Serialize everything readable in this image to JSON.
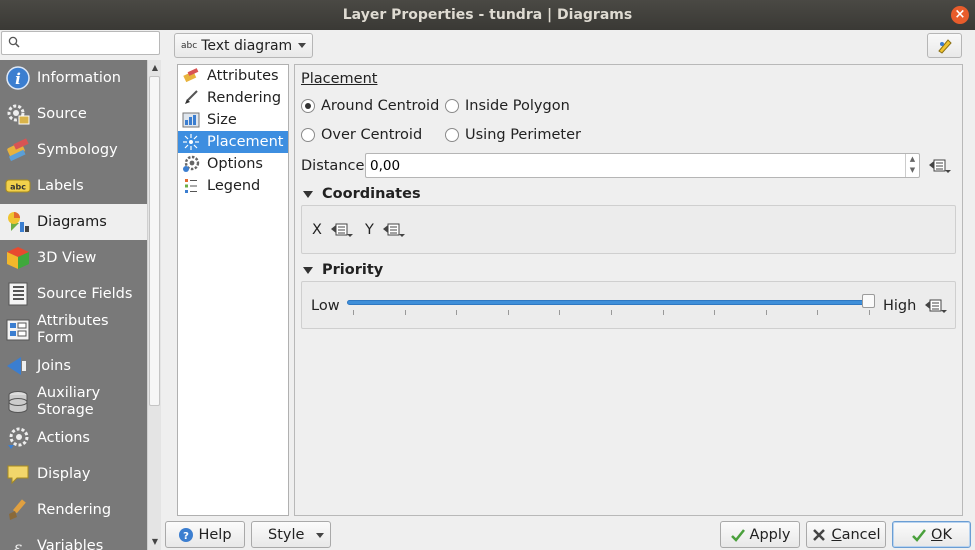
{
  "window": {
    "title": "Layer Properties - tundra | Diagrams",
    "close_glyph": "×"
  },
  "search": {
    "placeholder": ""
  },
  "sidebar": {
    "items": [
      {
        "label": "Information",
        "icon": "info-icon"
      },
      {
        "label": "Source",
        "icon": "source-icon"
      },
      {
        "label": "Symbology",
        "icon": "symbology-icon"
      },
      {
        "label": "Labels",
        "icon": "labels-icon"
      },
      {
        "label": "Diagrams",
        "icon": "diagrams-icon",
        "active": true
      },
      {
        "label": "3D View",
        "icon": "cube-icon"
      },
      {
        "label": "Source Fields",
        "icon": "fields-icon"
      },
      {
        "label": "Attributes\nForm",
        "icon": "form-icon"
      },
      {
        "label": "Joins",
        "icon": "joins-icon"
      },
      {
        "label": "Auxiliary\nStorage",
        "icon": "storage-icon"
      },
      {
        "label": "Actions",
        "icon": "actions-icon"
      },
      {
        "label": "Display",
        "icon": "display-icon"
      },
      {
        "label": "Rendering",
        "icon": "rendering-icon"
      },
      {
        "label": "Variables",
        "icon": "variables-icon"
      }
    ]
  },
  "diagram_type": {
    "prefix": "abc",
    "value": "Text diagram"
  },
  "subnav": {
    "items": [
      {
        "label": "Attributes"
      },
      {
        "label": "Rendering"
      },
      {
        "label": "Size"
      },
      {
        "label": "Placement",
        "active": true
      },
      {
        "label": "Options"
      },
      {
        "label": "Legend"
      }
    ]
  },
  "placement": {
    "title": "Placement",
    "options": {
      "around_centroid": "Around Centroid",
      "inside_polygon": "Inside Polygon",
      "over_centroid": "Over Centroid",
      "using_perimeter": "Using Perimeter"
    },
    "selected": "around_centroid",
    "distance_label": "Distance",
    "distance_value": "0,00"
  },
  "coordinates": {
    "title": "Coordinates",
    "x_label": "X",
    "y_label": "Y"
  },
  "priority": {
    "title": "Priority",
    "low_label": "Low",
    "high_label": "High",
    "value_fraction": 1.0
  },
  "buttons": {
    "help": "Help",
    "style": "Style",
    "apply": "Apply",
    "cancel_first": "C",
    "cancel_rest": "ancel",
    "ok_first": "O",
    "ok_rest": "K"
  },
  "colors": {
    "accent": "#3d8ee0",
    "sidebar_bg": "#797979",
    "titlebar": "#3d3c38",
    "close": "#e85c2b"
  }
}
